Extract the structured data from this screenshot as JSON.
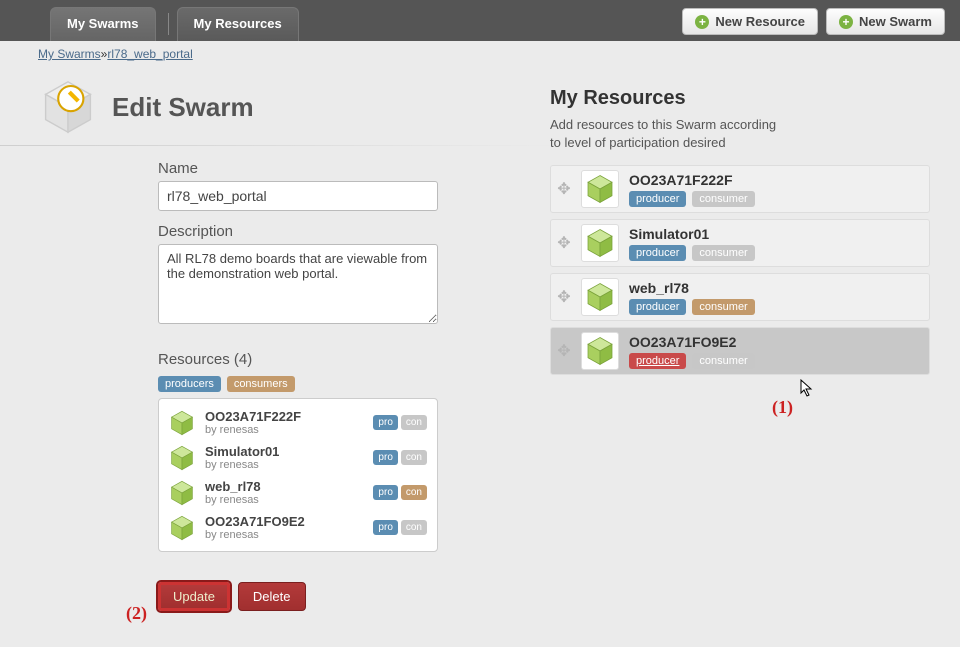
{
  "nav": {
    "tab_swarms": "My Swarms",
    "tab_resources": "My Resources",
    "btn_new_resource": "New Resource",
    "btn_new_swarm": "New Swarm"
  },
  "breadcrumb": {
    "root": "My Swarms",
    "sep": "»",
    "current": "rl78_web_portal"
  },
  "page": {
    "title": "Edit Swarm"
  },
  "form": {
    "name_label": "Name",
    "name_value": "rl78_web_portal",
    "desc_label": "Description",
    "desc_value": "All RL78 demo boards that are viewable from the demonstration web portal.",
    "resources_label": "Resources (4)",
    "badge_producers": "producers",
    "badge_consumers": "consumers",
    "tag_pro": "pro",
    "tag_con": "con",
    "by_prefix": "by ",
    "items": [
      {
        "name": "OO23A71F222F",
        "by": "renesas",
        "pro": true,
        "con": false
      },
      {
        "name": "Simulator01",
        "by": "renesas",
        "pro": true,
        "con": false
      },
      {
        "name": "web_rl78",
        "by": "renesas",
        "pro": true,
        "con": true
      },
      {
        "name": "OO23A71FO9E2",
        "by": "renesas",
        "pro": true,
        "con": false
      }
    ],
    "btn_update": "Update",
    "btn_delete": "Delete"
  },
  "panel": {
    "title": "My Resources",
    "subtitle": "Add resources to this Swarm according to level of participation desired",
    "tag_producer": "producer",
    "tag_consumer": "consumer",
    "items": [
      {
        "name": "OO23A71F222F",
        "producer": "blue",
        "consumer": "grey",
        "hi": false
      },
      {
        "name": "Simulator01",
        "producer": "blue",
        "consumer": "grey",
        "hi": false
      },
      {
        "name": "web_rl78",
        "producer": "blue",
        "consumer": "brown",
        "hi": false
      },
      {
        "name": "OO23A71FO9E2",
        "producer": "red",
        "consumer": "grey",
        "hi": true
      }
    ]
  },
  "annotations": {
    "a1": "(1)",
    "a2": "(2)"
  }
}
